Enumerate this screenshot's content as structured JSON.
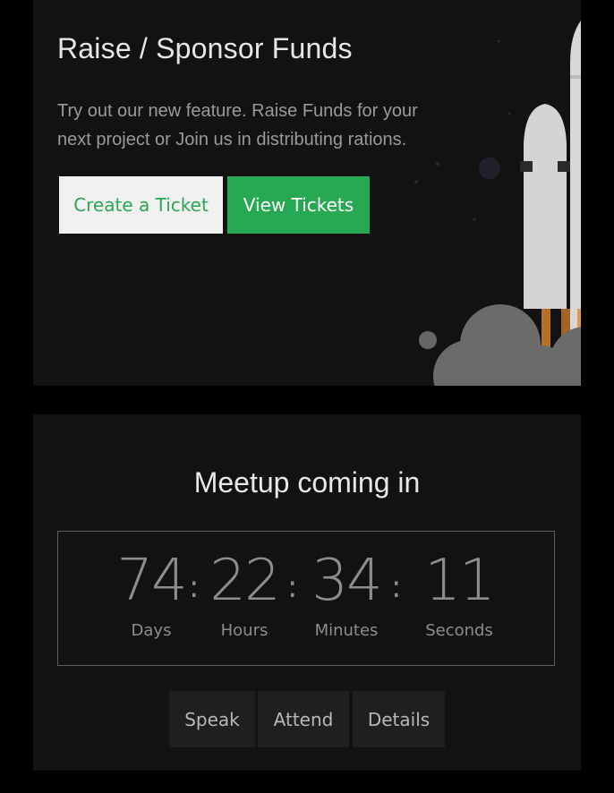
{
  "hero": {
    "title": "Raise / Sponsor Funds",
    "description": "Try out our new feature. Raise Funds for your next project or Join us in distributing rations.",
    "create_label": "Create a Ticket",
    "view_label": "View Tickets"
  },
  "meetup": {
    "title": "Meetup coming in",
    "countdown": {
      "days": "74",
      "days_label": "Days",
      "hours": "22",
      "hours_label": "Hours",
      "minutes": "34",
      "minutes_label": "Minutes",
      "seconds": "11",
      "seconds_label": "Seconds",
      "separator": ":"
    },
    "actions": {
      "speak": "Speak",
      "attend": "Attend",
      "details": "Details"
    }
  }
}
